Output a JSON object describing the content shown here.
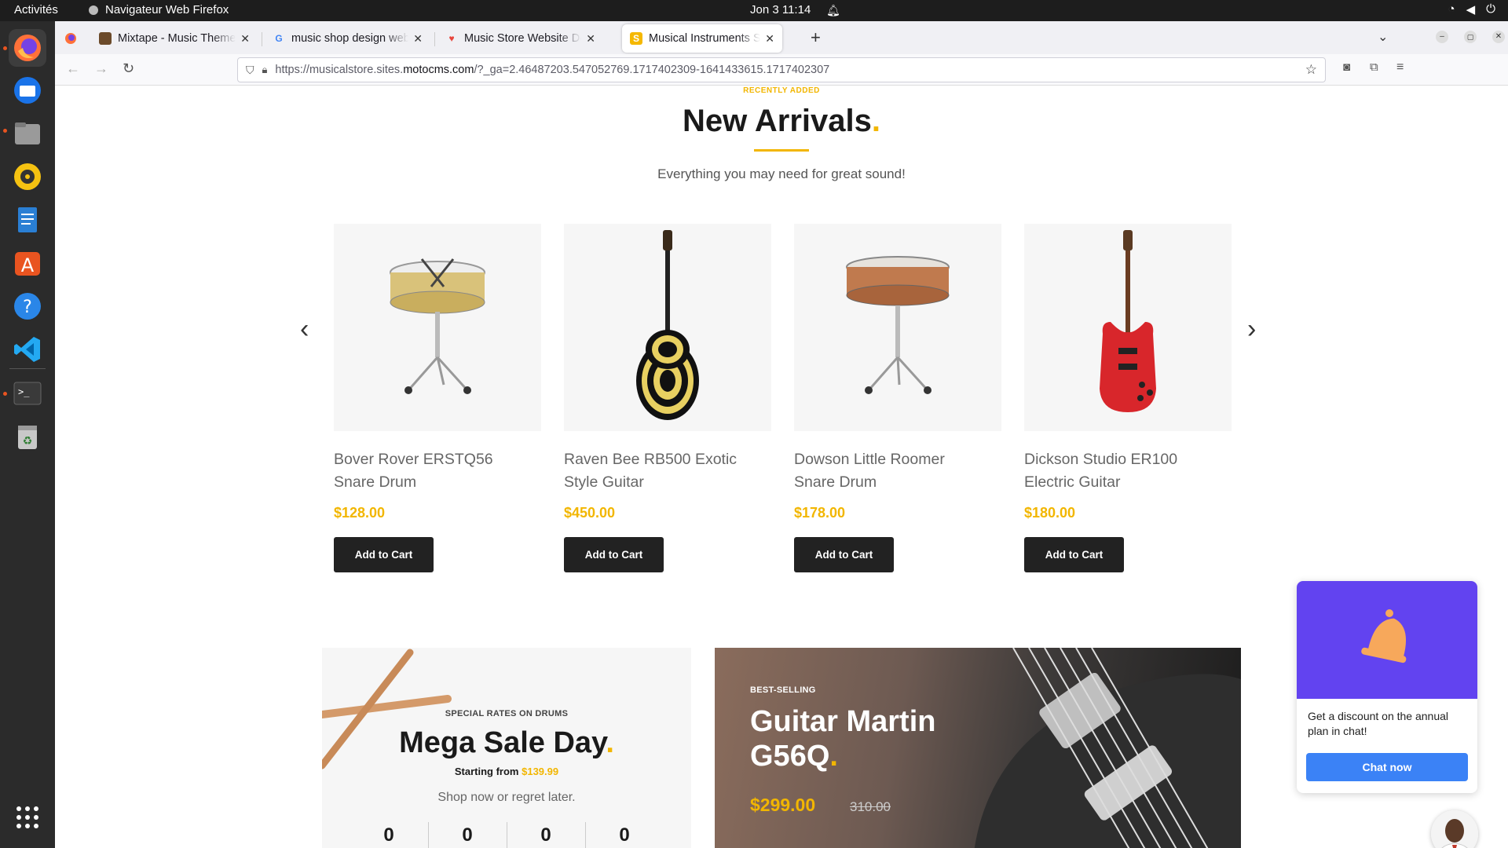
{
  "system": {
    "activities": "Activités",
    "app_name": "Navigateur Web Firefox",
    "clock": "Jon 3  11:14"
  },
  "browser": {
    "tabs": [
      {
        "title": "Mixtape - Music Theme f",
        "active": false
      },
      {
        "title": "music shop design web -",
        "active": false
      },
      {
        "title": "Music Store Website Des",
        "active": false
      },
      {
        "title": "Musical Instruments Stor",
        "active": true
      }
    ],
    "url_prefix": "https://musicalstore.sites.",
    "url_host": "motocms.com",
    "url_suffix": "/?_ga=2.46487203.547052769.1717402309-1641433615.1717402307"
  },
  "section": {
    "kicker": "RECENTLY ADDED",
    "title": "New Arrivals",
    "title_dot": ".",
    "subtitle": "Everything you may need for great sound!"
  },
  "products": [
    {
      "name_line1": "Bover Rover ERSTQ56",
      "name_line2": "Snare Drum",
      "price": "$128.00",
      "button": "Add to Cart"
    },
    {
      "name_line1": "Raven Bee RB500 Exotic",
      "name_line2": "Style Guitar",
      "price": "$450.00",
      "button": "Add to Cart"
    },
    {
      "name_line1": "Dowson Little Roomer",
      "name_line2": "Snare Drum",
      "price": "$178.00",
      "button": "Add to Cart"
    },
    {
      "name_line1": "Dickson Studio ER100",
      "name_line2": "Electric Guitar",
      "price": "$180.00",
      "button": "Add to Cart"
    }
  ],
  "promo_left": {
    "kicker": "SPECIAL RATES ON DRUMS",
    "title": "Mega Sale Day",
    "title_dot": ".",
    "starting_label": "Starting from ",
    "starting_price": "$139.99",
    "tagline": "Shop now or regret later.",
    "countdown": [
      "0",
      "0",
      "0",
      "0"
    ]
  },
  "promo_right": {
    "kicker": "BEST-SELLING",
    "title": "Guitar Martin G56Q",
    "title_dot": ".",
    "price": "$299.00",
    "old_price": "310.00"
  },
  "chat_widget": {
    "message": "Get a discount on the annual plan in chat!",
    "button": "Chat now"
  },
  "colors": {
    "accent": "#f2b600",
    "button_dark": "#222222",
    "chat_header": "#6243f0",
    "chat_button": "#3b82f6"
  }
}
